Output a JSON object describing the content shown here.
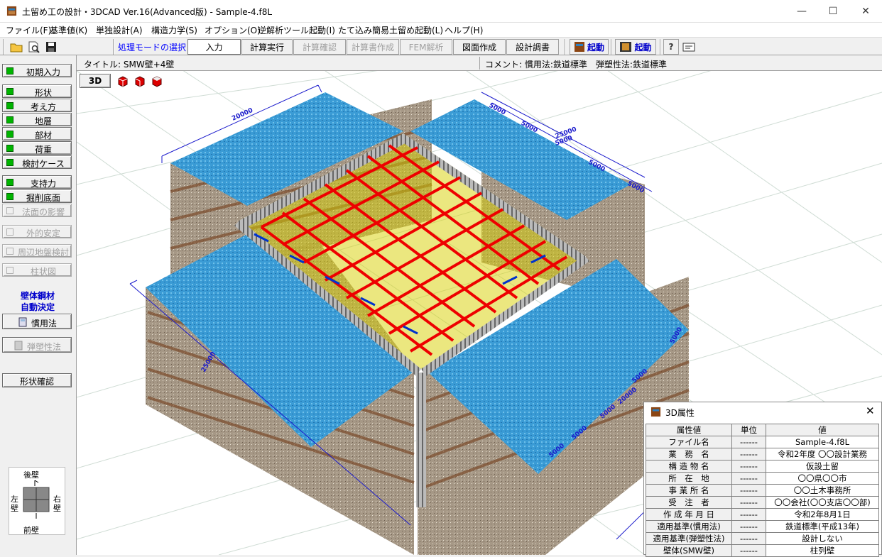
{
  "window": {
    "title": "土留め工の設計・3DCAD Ver.16(Advanced版) - Sample-4.f8L",
    "minimize": "—",
    "maximize": "☐",
    "close": "✕"
  },
  "menu": [
    "ファイル(F)",
    "基準値(K)",
    "単独設計(A)",
    "構造力学(S)",
    "オプション(O)",
    "逆解析ツール起動(I)",
    "たて込み簡易土留め起動(L)",
    "ヘルプ(H)"
  ],
  "toolbar": {
    "mode_label": "処理モードの選択",
    "buttons": [
      "入力",
      "計算実行",
      "計算確認",
      "計算書作成",
      "FEM解析",
      "図面作成",
      "設計調書"
    ],
    "launch1": "起動",
    "launch2": "起動",
    "help": "?"
  },
  "left": {
    "buttons": [
      "初期入力",
      "形状",
      "考え方",
      "地層",
      "部材",
      "荷重",
      "検討ケース",
      "支持力",
      "掘削底面",
      "法面の影響",
      "外的安定",
      "周辺地盤検討",
      "柱状図"
    ],
    "auto_line1": "壁体鋼材",
    "auto_line2": "自動決定",
    "method1": "慣用法",
    "method2": "弾塑性法",
    "shape_check": "形状確認",
    "minimap": {
      "back": "後壁",
      "front": "前壁",
      "left": "左\n壁",
      "right": "右\n壁"
    }
  },
  "info": {
    "title": "タイトル: SMW壁+4壁",
    "comment": "コメント: 慣用法:鉄道標準　弾塑性法:鉄道標準"
  },
  "view": {
    "btn3d": "3D",
    "dims": [
      "20000",
      "5000",
      "5000",
      "25000",
      "5000",
      "5000",
      "5000",
      "25000",
      "5000",
      "20000",
      "5000",
      "5000",
      "5000",
      "5000"
    ]
  },
  "attr": {
    "title": "3D属性",
    "headers": [
      "属性値",
      "単位",
      "値"
    ],
    "rows": [
      {
        "k": "ファイル名",
        "u": "------",
        "v": "Sample-4.f8L"
      },
      {
        "k": "業　務　名",
        "u": "------",
        "v": "令和2年度 〇〇設計業務"
      },
      {
        "k": "構 造 物 名",
        "u": "------",
        "v": "仮設土留"
      },
      {
        "k": "所　在　地",
        "u": "------",
        "v": "〇〇県〇〇市"
      },
      {
        "k": "事 業 所 名",
        "u": "------",
        "v": "〇〇土木事務所"
      },
      {
        "k": "受　注　者",
        "u": "------",
        "v": "〇〇会社(〇〇支店〇〇部)"
      },
      {
        "k": "作 成 年 月 日",
        "u": "------",
        "v": "令和2年8月1日"
      },
      {
        "k": "適用基準(慣用法)",
        "u": "------",
        "v": "鉄道標準(平成13年)"
      },
      {
        "k": "適用基準(弾塑性法)",
        "u": "------",
        "v": "設計しない"
      },
      {
        "k": "壁体(SMW壁)",
        "u": "------",
        "v": "柱列壁"
      }
    ]
  }
}
